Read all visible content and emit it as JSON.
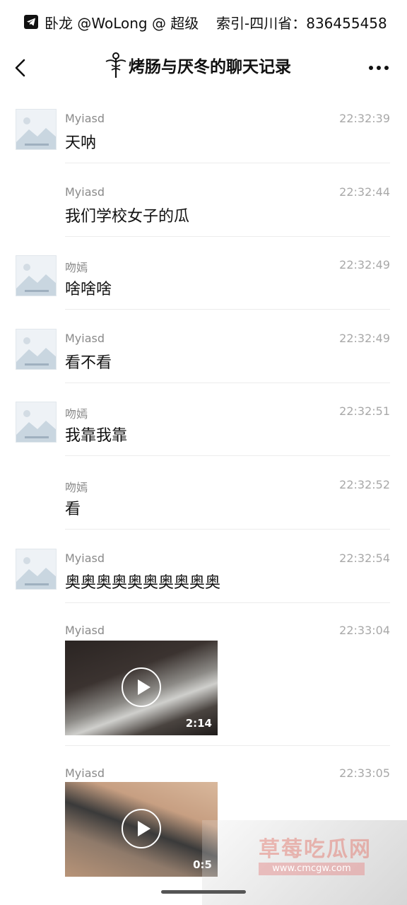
{
  "status_bar": {
    "left_text": "卧龙 @WoLong @ 超级",
    "right_text": "索引-四川省：836455458"
  },
  "navbar": {
    "title": "烤肠与厌冬的聊天记录",
    "back_icon": "chevron-left-icon",
    "more_icon": "more-dots-icon"
  },
  "messages": [
    {
      "sender": "Myiasd",
      "time": "22:32:39",
      "text": "天呐",
      "has_avatar": true
    },
    {
      "sender": "Myiasd",
      "time": "22:32:44",
      "text": "我们学校女子的瓜",
      "has_avatar": false
    },
    {
      "sender": "吻嫣",
      "time": "22:32:49",
      "text": "啥啥啥",
      "has_avatar": true
    },
    {
      "sender": "Myiasd",
      "time": "22:32:49",
      "text": "看不看",
      "has_avatar": true
    },
    {
      "sender": "吻嫣",
      "time": "22:32:51",
      "text": "我靠我靠",
      "has_avatar": true
    },
    {
      "sender": "吻嫣",
      "time": "22:32:52",
      "text": "看",
      "has_avatar": false
    },
    {
      "sender": "Myiasd",
      "time": "22:32:54",
      "text": "奥奥奥奥奥奥奥奥奥奥",
      "has_avatar": true
    },
    {
      "sender": "Myiasd",
      "time": "22:33:04",
      "video_duration": "2:14",
      "has_avatar": false
    },
    {
      "sender": "Myiasd",
      "time": "22:33:05",
      "video_duration": "0:5",
      "has_avatar": false
    }
  ],
  "overlay_watermark": {
    "name": "草莓吃瓜网",
    "url": "www.cmcgw.com"
  }
}
